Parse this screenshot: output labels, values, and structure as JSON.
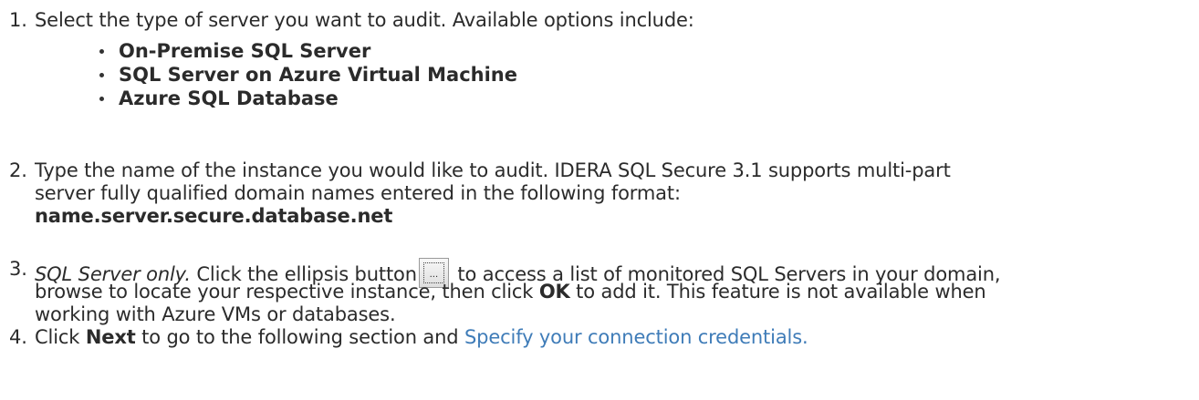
{
  "steps": [
    {
      "num": "1.",
      "text": "Select the type of server you want to audit. Available options include:",
      "options": [
        "On-Premise SQL Server",
        "SQL Server on Azure Virtual Machine",
        "Azure SQL Database"
      ]
    },
    {
      "num": "2.",
      "line1": "Type the name of the instance you would like to audit. IDERA SQL Secure 3.1 supports multi-part",
      "line2": "server fully qualified domain names entered in the following format:",
      "line3": "name.server.secure.database.net"
    },
    {
      "num": "3.",
      "italic_prefix": "SQL Server only.",
      "line1_before": " Click the ellipsis button",
      "button_glyph": "...",
      "line1_after": " to access a list of monitored SQL Servers in your domain,",
      "line2_before": "browse to locate your respective instance, then click ",
      "line2_bold": "OK",
      "line2_after": " to add it. This feature is not available when",
      "line3": "working with Azure VMs or databases."
    },
    {
      "num": "4.",
      "before": "Click ",
      "bold": "Next",
      "middle": " to go to the following section and ",
      "link": "Specify your connection credentials."
    }
  ],
  "colors": {
    "text": "#2b2b2b",
    "link": "#3f7cb8"
  },
  "icons": {
    "ellipsis_button": "ellipsis-button-icon",
    "bullet": "bullet-dot"
  }
}
